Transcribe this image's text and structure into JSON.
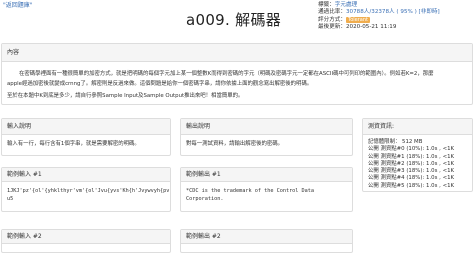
{
  "nav": {
    "back_label": "\"返回題庫\""
  },
  "problem": {
    "title": "a009. 解碼器"
  },
  "meta": {
    "label_tags": "標籤：",
    "tag": "字元處理",
    "label_solved": "通過比率：",
    "solved_value": "30788人/32378人 ( 95% ) [非即時]",
    "label_score": "評分方式：",
    "score_badge": "Tolerant",
    "label_updated": "最後更新：",
    "updated_value": "2020-05-21 11:19"
  },
  "content": {
    "heading": "內容",
    "para1_a": "在密碼學裡面有一種很簡單的加密方式，就是把明碼的每個字元加上某一個整數K而得到密碼的字元（明碼及密碼字元一定都在ASCII碼中可列印的範圍內）。例如若K=2，那麼",
    "para1_b": "apple經過加密後就變成crnng了。解密則是反過來做。這個問題是給你一個密碼字串，請你依據上面的觀念寫出解密後的明碼。",
    "para2": "至於在本題中K到底是多少，請自行參照Sample Input及Sample Output推出來吧！相當簡單的。"
  },
  "input_desc": {
    "heading": "輸入說明",
    "text": "輸入有一行，每行含有1個字串，就是需要解密的明碼。"
  },
  "output_desc": {
    "heading": "輸出說明",
    "text": "對每一測試資料，請輸出解密後的密碼。"
  },
  "limits": {
    "heading": "測資資訊:",
    "rows": [
      "記憶體限制： 512 MB",
      "公開 測資點#0 (10%): 1.0s , <1K",
      "公開 測資點#1 (18%): 1.0s , <1K",
      "公開 測資點#2 (18%): 1.0s , <1K",
      "公開 測資點#3 (18%): 1.0s , <1K",
      "公開 測資點#4 (18%): 1.0s , <1K",
      "公開 測資點#5 (18%): 1.0s , <1K"
    ]
  },
  "sample_input_1": {
    "heading": "範例輸入 #1",
    "line1": "1JKJ'pz'{ol'{yhklthyr'vm'{ol'Jvu{yvs'Kh{h'Jvywvyh{pv",
    "line2": "u5"
  },
  "sample_output_1": {
    "heading": "範例輸出 #1",
    "line1": "*CDC is the trademark of the Control Data",
    "line2": "Corporation."
  },
  "sample_input_2": {
    "heading": "範例輸入 #2"
  },
  "sample_output_2": {
    "heading": "範例輸出 #2"
  }
}
